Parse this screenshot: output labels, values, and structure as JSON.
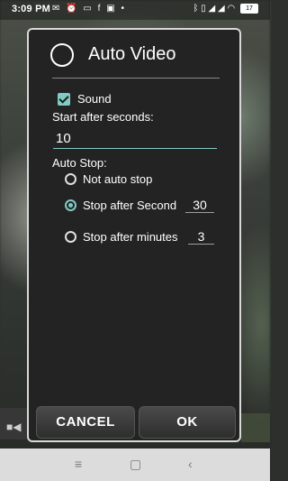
{
  "status_bar": {
    "time": "3:09 PM",
    "left_icons": [
      "mail-icon",
      "alarm-icon",
      "sd-card-icon",
      "facebook-icon",
      "bag-icon",
      "dot-icon"
    ],
    "right_icons": [
      "bluetooth-icon",
      "vibrate-icon",
      "signal-icon",
      "signal-icon",
      "wifi-icon"
    ],
    "battery_level": "17"
  },
  "dialog": {
    "title": "Auto Video",
    "sound": {
      "label": "Sound",
      "checked": true
    },
    "start_after_label": "Start after seconds:",
    "start_after_value": "10",
    "auto_stop_label": "Auto Stop:",
    "options": [
      {
        "label": "Not auto stop",
        "selected": false
      },
      {
        "label": "Stop after Second",
        "selected": true,
        "value": "30"
      },
      {
        "label": "Stop after minutes",
        "selected": false,
        "value": "3"
      }
    ],
    "cancel_label": "CANCEL",
    "ok_label": "OK"
  },
  "navbar": {
    "menu": "≡",
    "home": "▢",
    "back": "‹"
  },
  "colors": {
    "accent": "#80cbc4",
    "dialog_bg": "#232323",
    "navbar_bg": "#dcdcdc"
  }
}
